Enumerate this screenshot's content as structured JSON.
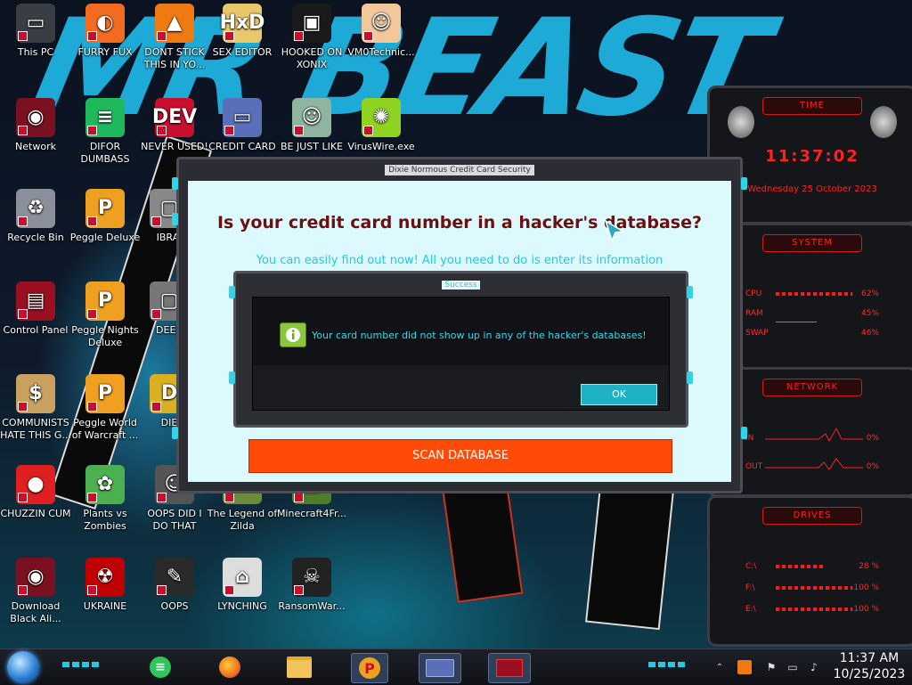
{
  "desktop_icons": [
    {
      "label": "This PC",
      "color": "#3a3d44",
      "symbol": "▭"
    },
    {
      "label": "FURRY FUX",
      "color": "#f26b1f",
      "symbol": "◐"
    },
    {
      "label": "DONT STICK THIS IN YO...",
      "color": "#f07a12",
      "symbol": "▲"
    },
    {
      "label": "SEX EDITOR",
      "color": "#e9c86b",
      "symbol": "HxD"
    },
    {
      "label": "HOOKED ON XONIX",
      "color": "#1a1a1a",
      "symbol": "▣"
    },
    {
      "label": "VM0Technic...",
      "color": "#f3c79b",
      "symbol": "☺"
    },
    {
      "label": "Network",
      "color": "#7a1020",
      "symbol": "◉"
    },
    {
      "label": "DIFOR DUMBASS",
      "color": "#1fb95c",
      "symbol": "≡"
    },
    {
      "label": "NEVER USED!",
      "color": "#c8102e",
      "symbol": "DEV"
    },
    {
      "label": "CREDIT CARD",
      "color": "#5b6fb8",
      "symbol": "▭"
    },
    {
      "label": "BE JUST LIKE",
      "color": "#8fb5a0",
      "symbol": "☺"
    },
    {
      "label": "VirusWire.exe",
      "color": "#8ed321",
      "symbol": "✺"
    },
    {
      "label": "Recycle Bin",
      "color": "#8a8f99",
      "symbol": "♻"
    },
    {
      "label": "Peggle Deluxe",
      "color": "#f0a020",
      "symbol": "P"
    },
    {
      "label": "Control Panel",
      "color": "#9a1020",
      "symbol": "▤"
    },
    {
      "label": "Peggle Nights Deluxe",
      "color": "#f0a020",
      "symbol": "P"
    },
    {
      "label": "COMMUNISTS HATE THIS G...",
      "color": "#c8a060",
      "symbol": "$"
    },
    {
      "label": "Peggle World of Warcraft ...",
      "color": "#f0a020",
      "symbol": "P"
    },
    {
      "label": "CHUZZIN CUM",
      "color": "#e02020",
      "symbol": "●"
    },
    {
      "label": "Plants vs Zombies",
      "color": "#4caf50",
      "symbol": "✿"
    },
    {
      "label": "OOPS DID I DO THAT",
      "color": "#555555",
      "symbol": "☺"
    },
    {
      "label": "The Legend of Zilda",
      "color": "#6d8c3a",
      "symbol": "◆"
    },
    {
      "label": "Minecraft4Fr...",
      "color": "#4f7d2a",
      "symbol": "▩"
    },
    {
      "label": "Download Black Ali...",
      "color": "#7a1020",
      "symbol": "◉"
    },
    {
      "label": "UKRAINE",
      "color": "#c00000",
      "symbol": "☢"
    },
    {
      "label": "OOPS",
      "color": "#2a2a2a",
      "symbol": "✎"
    },
    {
      "label": "LYNCHING",
      "color": "#dddddd",
      "symbol": "⌂"
    },
    {
      "label": "RansomWar...",
      "color": "#222222",
      "symbol": "☠"
    },
    {
      "label": "IBRAI",
      "color": "#888888",
      "symbol": "▢"
    },
    {
      "label": "DEEZ",
      "color": "#777777",
      "symbol": "▢"
    },
    {
      "label": "DIE",
      "color": "#d8b020",
      "symbol": "D"
    }
  ],
  "wallpaper": {
    "text": "MR BEAST"
  },
  "gauges": {
    "time": {
      "title": "TIME",
      "clock": "11:37:02",
      "date": "Wednesday 25 October 2023"
    },
    "system": {
      "title": "SYSTEM",
      "rows": [
        {
          "label": "CPU",
          "value": "62%"
        },
        {
          "label": "RAM",
          "value": "45%"
        },
        {
          "label": "SWAP",
          "value": "46%"
        }
      ]
    },
    "network": {
      "title": "NETWORK",
      "rows": [
        {
          "label": "IN",
          "value": "0%"
        },
        {
          "label": "OUT",
          "value": "0%"
        }
      ]
    },
    "drives": {
      "title": "DRIVES",
      "rows": [
        {
          "label": "C:\\",
          "value": "28 %"
        },
        {
          "label": "F:\\",
          "value": "100 %"
        },
        {
          "label": "E:\\",
          "value": "100 %"
        }
      ]
    }
  },
  "main_window": {
    "title": "Dixie Normous Credit Card Security",
    "heading": "Is your credit card number in a hacker's database?",
    "subheading": "You can easily find out now! All you need to do is enter its information",
    "scan_button": "SCAN DATABASE"
  },
  "dialog": {
    "title": "Success",
    "message": "Your card number did not show up in any of the hacker's databases!",
    "ok_button": "OK",
    "icon": "info-icon"
  },
  "taskbar": {
    "clock_time": "11:37 AM",
    "clock_date": "10/25/2023",
    "pinned": [
      "discord",
      "firefox",
      "file-explorer",
      "peggle",
      "credit-card-app",
      "control-panel"
    ]
  }
}
